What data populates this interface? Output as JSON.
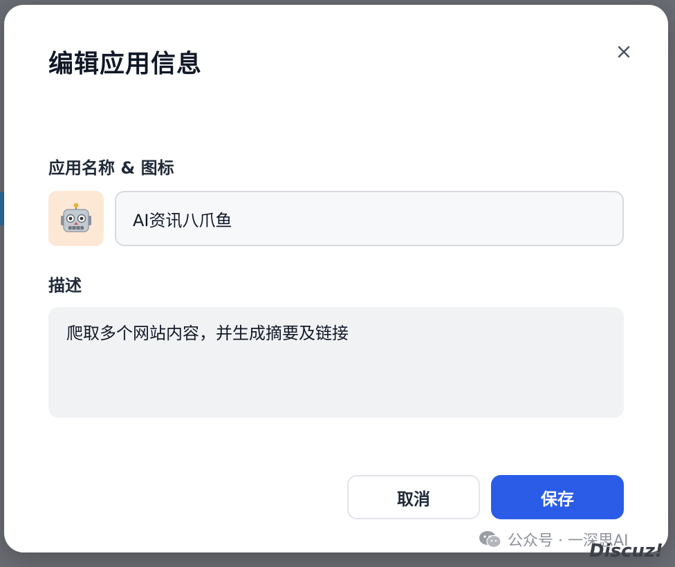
{
  "dialog": {
    "title": "编辑应用信息",
    "close_icon": "close-icon"
  },
  "form": {
    "name_label": "应用名称 & 图标",
    "app_icon": "robot-emoji-icon",
    "name_value": "AI资讯八爪鱼",
    "desc_label": "描述",
    "desc_value": "爬取多个网站内容，并生成摘要及链接"
  },
  "actions": {
    "cancel_label": "取消",
    "save_label": "保存",
    "save_color": "#2a5ce8"
  },
  "watermark": {
    "text": "公众号 · 一深思AI",
    "site": "Discuz!"
  }
}
